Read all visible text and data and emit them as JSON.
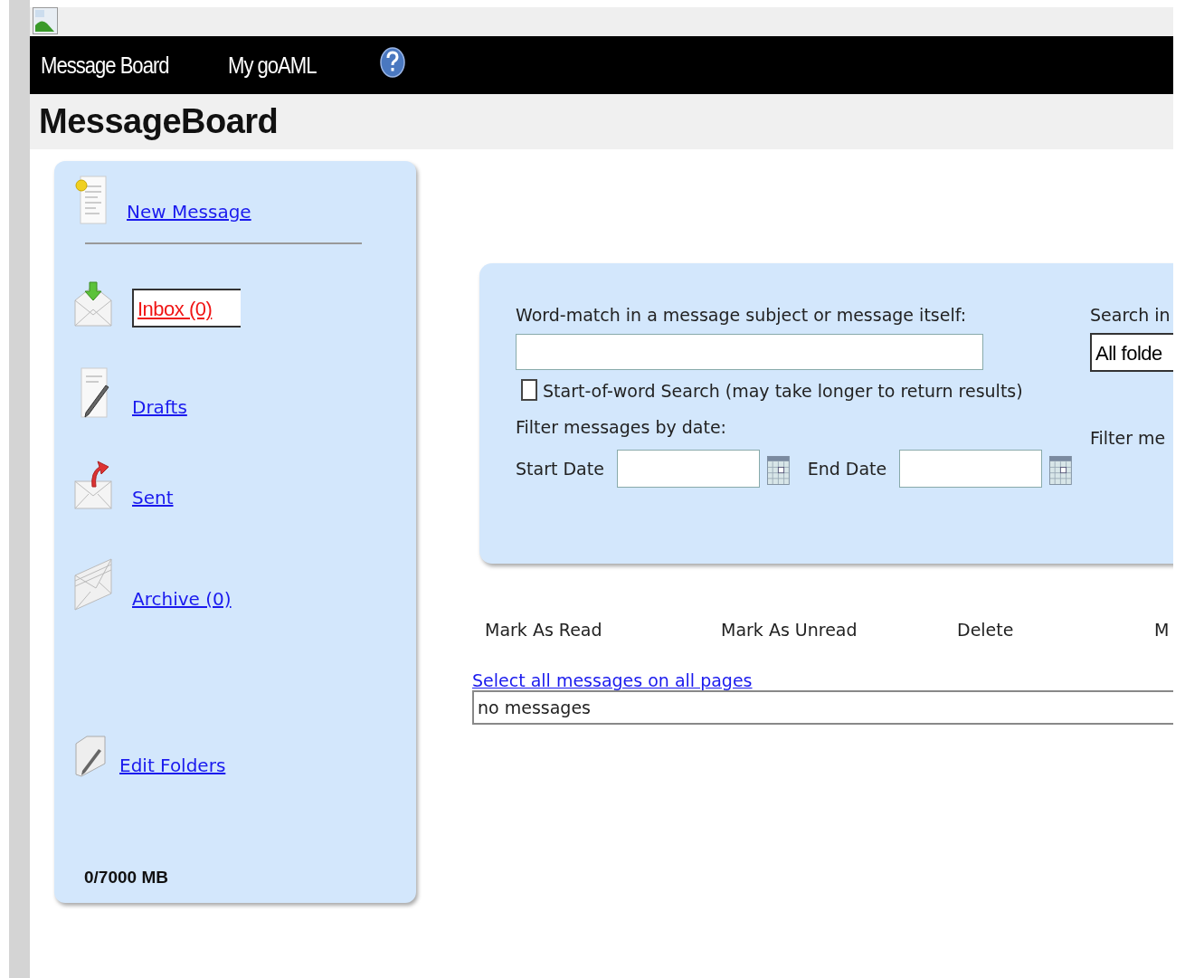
{
  "header": {
    "nav": [
      {
        "label": "Message Board"
      },
      {
        "label": "My goAML"
      }
    ],
    "title": "MessageBoard"
  },
  "sidebar": {
    "new_message": "New Message",
    "folders": [
      {
        "label": "Inbox (0)",
        "kind": "inbox",
        "selected": true
      },
      {
        "label": "Drafts",
        "kind": "drafts",
        "selected": false
      },
      {
        "label": "Sent",
        "kind": "sent",
        "selected": false
      },
      {
        "label": "Archive (0)",
        "kind": "archive",
        "selected": false
      }
    ],
    "edit_folders": "Edit Folders",
    "quota": "0/7000 MB"
  },
  "search": {
    "word_label": "Word-match in a message subject or message itself:",
    "start_of_word": {
      "label": "Start-of-word Search (may take longer to return results)",
      "checked": false
    },
    "date_label": "Filter messages by date:",
    "start_date_label": "Start Date",
    "end_date_label": "End Date",
    "search_in_label": "Search in",
    "search_in_value": "All folde",
    "filter_label": "Filter me"
  },
  "actions": [
    "Mark As Read",
    "Mark As Unread",
    "Delete",
    "M"
  ],
  "select_all": "Select all messages on all pages",
  "messages_empty": "no messages"
}
